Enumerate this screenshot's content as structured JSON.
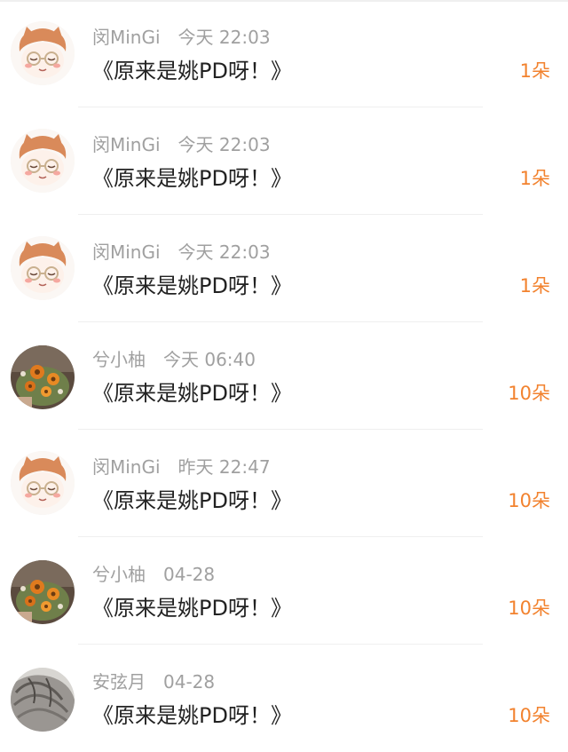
{
  "colors": {
    "name_meta": "#a0a0a0",
    "content_text": "#222222",
    "gift_accent": "#f2822e",
    "divider": "#efefef"
  },
  "comments": [
    {
      "avatar": "cartoon-glasses-avatar",
      "name": "闵MinGi",
      "time": "今天  22:03",
      "text": "《原来是姚PD呀！》",
      "gift": "1朵"
    },
    {
      "avatar": "cartoon-glasses-avatar",
      "name": "闵MinGi",
      "time": "今天  22:03",
      "text": "《原来是姚PD呀！》",
      "gift": "1朵"
    },
    {
      "avatar": "cartoon-glasses-avatar",
      "name": "闵MinGi",
      "time": "今天  22:03",
      "text": "《原来是姚PD呀！》",
      "gift": "1朵"
    },
    {
      "avatar": "flower-bouquet-avatar",
      "name": "兮小柚",
      "time": "今天  06:40",
      "text": "《原来是姚PD呀！》",
      "gift": "10朵"
    },
    {
      "avatar": "cartoon-glasses-avatar",
      "name": "闵MinGi",
      "time": "昨天  22:47",
      "text": "《原来是姚PD呀！》",
      "gift": "10朵"
    },
    {
      "avatar": "flower-bouquet-avatar",
      "name": "兮小柚",
      "time": "04-28",
      "text": "《原来是姚PD呀！》",
      "gift": "10朵"
    },
    {
      "avatar": "grey-hair-avatar",
      "name": "安弦月",
      "time": "04-28",
      "text": "《原来是姚PD呀！》",
      "gift": "10朵"
    }
  ]
}
